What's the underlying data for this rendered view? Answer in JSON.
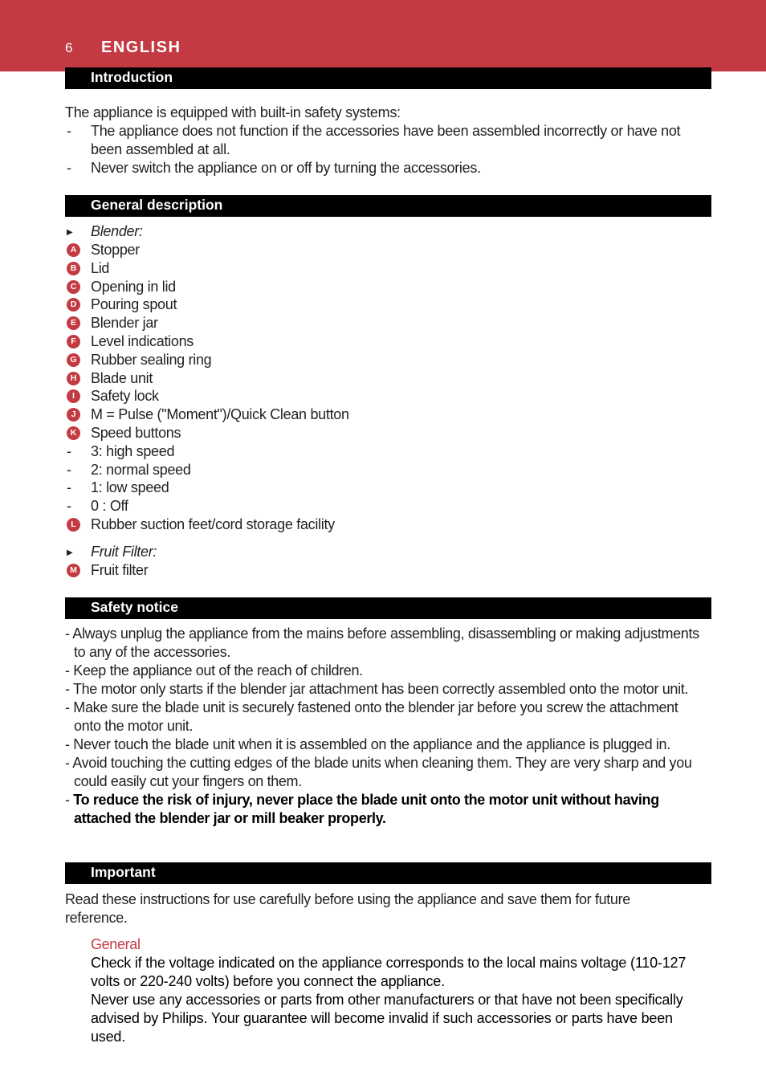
{
  "header": {
    "page_number": "6",
    "language": "ENGLISH",
    "banner_color": "#c43a43"
  },
  "introduction": {
    "title": "Introduction",
    "lead": "The appliance is equipped with built-in safety systems:",
    "items": [
      "The appliance does not function if the accessories have been assembled incorrectly or have not",
      "been assembled at all.",
      "Never switch the appliance on or off by turning the accessories."
    ]
  },
  "general_description": {
    "title": "General description",
    "blender_heading": "Blender:",
    "blender_parts": [
      {
        "badge": "A",
        "label": "Stopper"
      },
      {
        "badge": "B",
        "label": "Lid"
      },
      {
        "badge": "C",
        "label": "Opening in lid"
      },
      {
        "badge": "D",
        "label": "Pouring spout"
      },
      {
        "badge": "E",
        "label": "Blender jar"
      },
      {
        "badge": "F",
        "label": "Level indications"
      },
      {
        "badge": "G",
        "label": "Rubber sealing ring"
      },
      {
        "badge": "H",
        "label": "Blade unit"
      },
      {
        "badge": "I",
        "label": "Safety lock"
      },
      {
        "badge": "J",
        "label": "M = Pulse (\"Moment\")/Quick Clean button"
      },
      {
        "badge": "K",
        "label": "Speed buttons"
      }
    ],
    "speeds": [
      "3: high speed",
      "2: normal speed",
      "1: low speed",
      "0 : Off"
    ],
    "part_l": {
      "badge": "L",
      "label": "Rubber suction feet/cord storage facility"
    },
    "fruit_heading": "Fruit Filter:",
    "part_m": {
      "badge": "M",
      "label": "Fruit filter"
    }
  },
  "safety_notice": {
    "title": "Safety notice",
    "items": [
      "- Always unplug the appliance from the mains before assembling, disassembling or making adjustments to any of the accessories.",
      "- Keep the appliance out of the reach of children.",
      "- The motor only starts if the blender jar attachment has been correctly assembled onto the motor unit.",
      "- Make sure the blade unit is securely fastened onto the blender jar before you screw the attachment onto the motor unit.",
      "- Never touch the blade unit when it is assembled on the appliance and the appliance is plugged in.",
      "- Avoid touching the cutting edges of the blade units when cleaning them. They are  very sharp and you could easily cut your fingers on them."
    ],
    "bold_item_dash": "- ",
    "bold_item": "To reduce the risk of injury, never place the blade unit onto the motor unit without having attached the blender jar or mill beaker properly."
  },
  "important": {
    "title": "Important",
    "lead": "Read these instructions for use carefully before using the appliance and save them for future reference.",
    "subheading": "General",
    "paragraphs": [
      "Check if the voltage indicated on the appliance corresponds to the local mains voltage (110-127 volts or 220-240 volts) before you connect the appliance.",
      "Never use any accessories or parts from other manufacturers or that have not been specifically advised by Philips. Your guarantee will become invalid if such accessories or parts have been used."
    ]
  }
}
